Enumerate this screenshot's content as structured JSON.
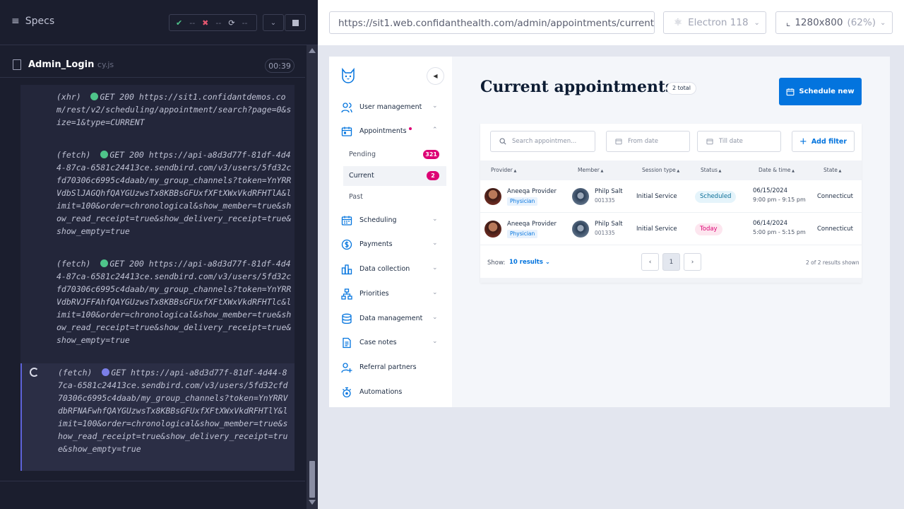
{
  "runner": {
    "specs_label": "Specs",
    "stats": {
      "passed": "--",
      "failed": "--",
      "pending": "--"
    },
    "spec_file": {
      "name": "Admin_Login",
      "ext": "cy.js",
      "duration": "00:39"
    },
    "logs": [
      {
        "type": "(xhr)",
        "method": "GET 200",
        "url": "https://sit1.confidantdemos.com/rest/v2/scheduling/appointment/search?page=0&size=1&type=CURRENT",
        "status": "done"
      },
      {
        "type": "(fetch)",
        "method": "GET 200",
        "url": "https://api-a8d3d77f-81df-4d44-87ca-6581c24413ce.sendbird.com/v3/users/5fd32cfd70306c6995c4daab/my_group_channels?token=YnYRRVdbSlJAGQhfQAYGUzwsTx8KBBsGFUxfXFtXWxVkdRFHTlA&limit=100&order=chronological&show_member=true&show_read_receipt=true&show_delivery_receipt=true&show_empty=true",
        "status": "done"
      },
      {
        "type": "(fetch)",
        "method": "GET 200",
        "url": "https://api-a8d3d77f-81df-4d44-87ca-6581c24413ce.sendbird.com/v3/users/5fd32cfd70306c6995c4daab/my_group_channels?token=YnYRRVdbRVJFFAhfQAYGUzwsTx8KBBsGFUxfXFtXWxVkdRFHTlc&limit=100&order=chronological&show_member=true&show_read_receipt=true&show_delivery_receipt=true&show_empty=true",
        "status": "done"
      },
      {
        "type": "(fetch)",
        "method": "GET",
        "url": "https://api-a8d3d77f-81df-4d44-87ca-6581c24413ce.sendbird.com/v3/users/5fd32cfd70306c6995c4daab/my_group_channels?token=YnYRRVdbRFNAFwhfQAYGUzwsTx8KBBsGFUxfXFtXWxVkdRFHTlY&limit=100&order=chronological&show_member=true&show_read_receipt=true&show_delivery_receipt=true&show_empty=true",
        "status": "pending"
      }
    ]
  },
  "browser": {
    "url": "https://sit1.web.confidanthealth.com/admin/appointments/current",
    "engine": "Electron 118",
    "viewport": "1280x800",
    "zoom": "(62%)"
  },
  "app": {
    "nav": [
      {
        "label": "User management",
        "icon": "users-icon"
      },
      {
        "label": "Appointments",
        "icon": "calendar-icon"
      },
      {
        "label": "Scheduling",
        "icon": "calendar-grid-icon"
      },
      {
        "label": "Payments",
        "icon": "dollar-icon"
      },
      {
        "label": "Data collection",
        "icon": "chart-icon"
      },
      {
        "label": "Priorities",
        "icon": "hierarchy-icon"
      },
      {
        "label": "Data management",
        "icon": "database-icon"
      },
      {
        "label": "Case notes",
        "icon": "document-icon"
      },
      {
        "label": "Referral partners",
        "icon": "user-plus-icon"
      },
      {
        "label": "Automations",
        "icon": "automation-icon"
      }
    ],
    "sub_nav": [
      {
        "label": "Pending",
        "badge": "321"
      },
      {
        "label": "Current",
        "badge": "2"
      },
      {
        "label": "Past",
        "badge": ""
      }
    ],
    "title": "Current appointments",
    "total": "2 total",
    "schedule_button": "Schedule new",
    "search_placeholder": "Search appointmen...",
    "from_date": "From date",
    "till_date": "Till date",
    "add_filter": "Add filter",
    "columns": [
      "Provider",
      "Member",
      "Session type",
      "Status",
      "Date & time",
      "State"
    ],
    "rows": [
      {
        "provider": "Aneeqa Provider",
        "role": "Physician",
        "member": "Philp Salt",
        "member_id": "001335",
        "session": "Initial Service",
        "status": "Scheduled",
        "date": "06/15/2024",
        "time": "9:00 pm - 9:15 pm",
        "state": "Connecticut"
      },
      {
        "provider": "Aneeqa Provider",
        "role": "Physician",
        "member": "Philp Salt",
        "member_id": "001335",
        "session": "Initial Service",
        "status": "Today",
        "date": "06/14/2024",
        "time": "5:00 pm - 5:15 pm",
        "state": "Connecticut"
      }
    ],
    "show_label": "Show:",
    "show_value": "10 results",
    "page": "1",
    "results_shown": "2 of 2 results shown"
  }
}
